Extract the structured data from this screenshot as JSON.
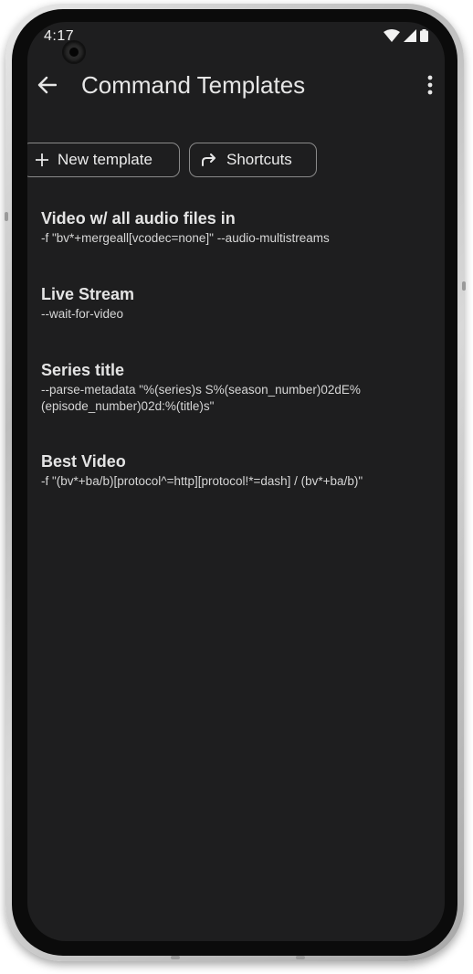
{
  "status_bar": {
    "time": "4:17",
    "icons": [
      "wifi-icon",
      "signal-icon",
      "battery-icon"
    ]
  },
  "app_bar": {
    "title": "Command Templates",
    "back_icon": "arrow-back-icon",
    "menu_icon": "more-vert-icon"
  },
  "actions": {
    "new_template_label": "New template",
    "new_template_icon": "plus-icon",
    "shortcuts_label": "Shortcuts",
    "shortcuts_icon": "redo-arrow-icon"
  },
  "templates": [
    {
      "title": "Video w/ all audio files in",
      "command": "-f \"bv*+mergeall[vcodec=none]\" --audio-multistreams"
    },
    {
      "title": "Live Stream",
      "command": "--wait-for-video"
    },
    {
      "title": "Series title",
      "command": "--parse-metadata \"%(series)s S%(season_number)02dE%(episode_number)02d:%(title)s\""
    },
    {
      "title": "Best Video",
      "command": "-f \"(bv*+ba/b)[protocol^=http][protocol!*=dash] / (bv*+ba/b)\""
    }
  ],
  "colors": {
    "screen_background": "#1e1e1f",
    "text_primary": "#e6e6e6",
    "chip_border": "#8a8a8a"
  }
}
